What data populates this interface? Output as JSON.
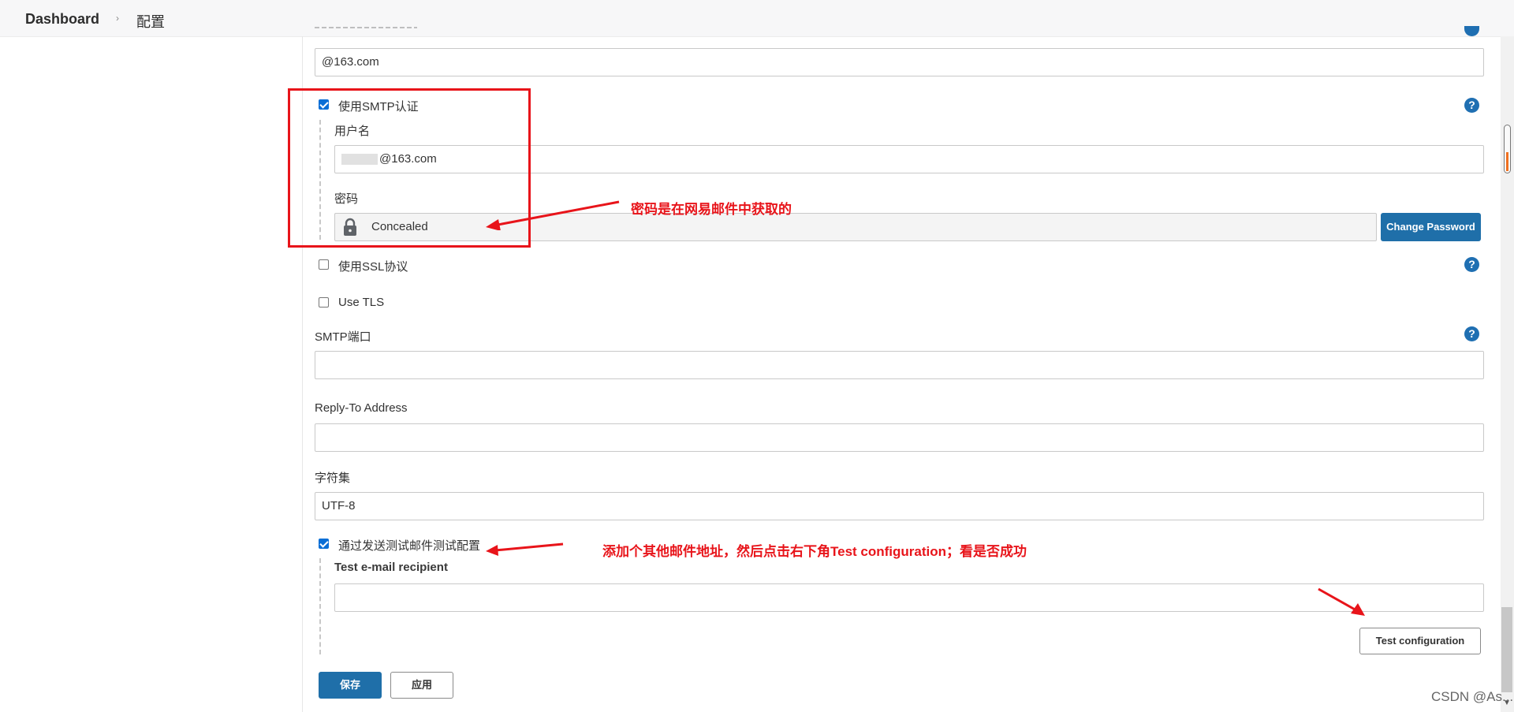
{
  "breadcrumb": {
    "home": "Dashboard",
    "separator": "›",
    "current": "配置"
  },
  "fields": {
    "email_suffix_value": "@163.com",
    "smtp_auth_label": "使用SMTP认证",
    "username_label": "用户名",
    "username_value": "@163.com",
    "password_label": "密码",
    "password_value": "Concealed",
    "change_password_label": "Change Password",
    "ssl_label": "使用SSL协议",
    "tls_label": "Use TLS",
    "smtp_port_label": "SMTP端口",
    "smtp_port_value": "",
    "reply_to_label": "Reply-To Address",
    "reply_to_value": "",
    "charset_label": "字符集",
    "charset_value": "UTF-8",
    "test_mail_label": "通过发送测试邮件测试配置",
    "test_recipient_label": "Test e-mail recipient",
    "test_recipient_value": "",
    "test_config_button": "Test configuration"
  },
  "checkboxes": {
    "smtp_auth": true,
    "ssl": false,
    "tls": false,
    "test_mail": true
  },
  "buttons": {
    "save": "保存",
    "apply": "应用"
  },
  "help_icon": "?",
  "annotations": {
    "password_note": "密码是在网易邮件中获取的",
    "test_note": "添加个其他邮件地址，然后点击右下角Test configuration；看是否成功"
  },
  "watermark": "CSDN @As...",
  "colors": {
    "accent": "#1f6fa9",
    "annotation": "#e8141a",
    "checkbox": "#0b6fd6"
  },
  "icons": {
    "lock": "lock-icon",
    "help": "help-icon"
  }
}
